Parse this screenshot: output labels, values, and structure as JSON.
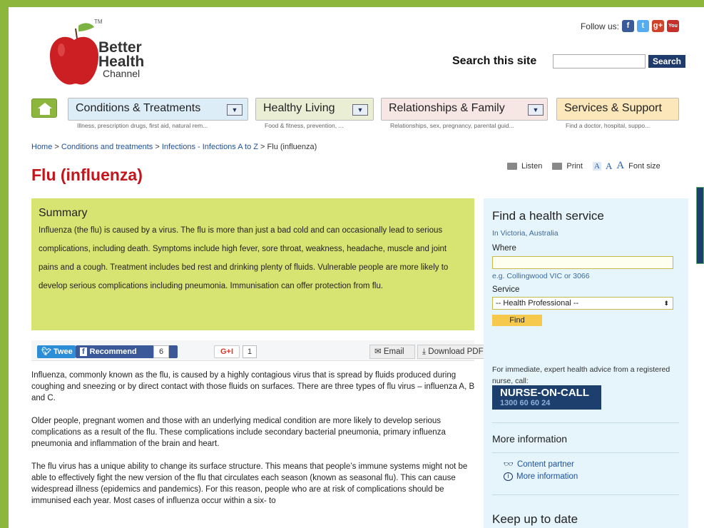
{
  "brand": {
    "name_line1": "Better",
    "name_line2": "Health",
    "name_line3": "Channel",
    "tm": "TM"
  },
  "header": {
    "follow_label": "Follow us:",
    "social": [
      {
        "icon": "facebook-icon",
        "glyph": "f"
      },
      {
        "icon": "twitter-icon",
        "glyph": "t"
      },
      {
        "icon": "google-plus-icon",
        "glyph": "g+"
      },
      {
        "icon": "youtube-icon",
        "glyph": "You"
      }
    ],
    "search_label": "Search this site",
    "search_value": "",
    "search_button": "Search"
  },
  "nav": {
    "items": [
      {
        "label": "Conditions & Treatments",
        "sub": "Illness, prescription drugs, first aid, natural rem..."
      },
      {
        "label": "Healthy Living",
        "sub": "Food & fitness, prevention, ..."
      },
      {
        "label": "Relationships & Family",
        "sub": "Relationships, sex, pregnancy, parental guid..."
      },
      {
        "label": "Services & Support",
        "sub": "Find a doctor, hospital, suppo..."
      }
    ]
  },
  "breadcrumb": {
    "home": "Home",
    "sep": " > ",
    "crumb1": "Conditions and treatments",
    "crumb2": "Infections - Infections A to Z",
    "current": "Flu (influenza)"
  },
  "tools": {
    "listen": "Listen",
    "print": "Print",
    "font_a": "A",
    "font_size": "Font size"
  },
  "page": {
    "title": "Flu (influenza)"
  },
  "summary": {
    "heading": "Summary",
    "text": "Influenza (the flu) is caused by a virus. The flu is more than just a bad cold and can occasionally lead to serious complications, including death. Symptoms include high fever, sore throat, weakness, headache, muscle and joint pains and a cough. Treatment includes bed rest and drinking plenty of fluids. Vulnerable people are more likely to develop serious complications including pneumonia. Immunisation can offer protection from flu."
  },
  "share": {
    "tweet": "Twee",
    "recommend": "Recommend",
    "recommend_count": "6",
    "gplus": "G+I",
    "gplus_count": "1",
    "email": "Email",
    "pdf": "Download PDF"
  },
  "body": {
    "paragraphs": [
      "Influenza, commonly known as the flu, is caused by a highly contagious virus that is spread by fluids produced during coughing and sneezing or by direct contact with those fluids on surfaces. There are three types of flu virus – influenza A, B and C.",
      "Older people, pregnant women and those with an underlying medical condition are more likely to develop serious complications as a result of the flu. These complications include secondary bacterial pneumonia, primary influenza pneumonia and inflammation of the brain and heart.",
      "The flu virus has a unique ability to change its surface structure. This means that people’s immune systems might not be able to effectively fight the new version of the flu that circulates each season (known as seasonal flu). This can cause widespread illness (epidemics and pandemics). For this reason, people who are at risk of complications should be immunised each year. Most cases of influenza occur within a six- to"
    ]
  },
  "sidebar": {
    "find_heading": "Find a health service",
    "region": "In Victoria, Australia",
    "where_label": "Where",
    "where_value": "",
    "where_hint": "e.g. Collingwood VIC or 3066",
    "service_label": "Service",
    "service_selected": "-- Health Professional --",
    "find_button": "Find",
    "nurse_text": "For immediate, expert health advice from a registered nurse, call:",
    "nurse_logo": "NURSE-ON-CALL",
    "nurse_number": "1300 60 60 24",
    "more_heading": "More information",
    "more_links": [
      "Content partner",
      "More information"
    ],
    "keep_heading": "Keep up to date"
  },
  "colors": {
    "accent_green": "#8db63c",
    "title_red": "#c2161c",
    "summary_bg": "#d8e471",
    "sidebar_bg": "#e5f5fb",
    "link_blue": "#1d4f9a"
  }
}
